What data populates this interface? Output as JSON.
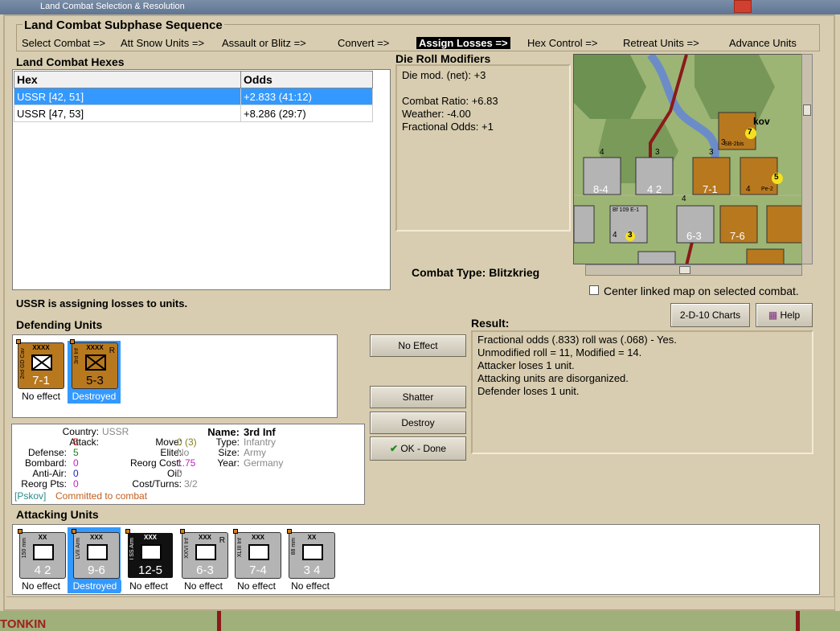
{
  "window": {
    "title": "Land Combat Selection & Resolution",
    "close_icon": "close-icon"
  },
  "sequence": {
    "title": "Land Combat Subphase Sequence",
    "steps": [
      "Select Combat =>",
      "Att Snow Units =>",
      "Assault or Blitz =>",
      "Convert =>",
      "Assign Losses =>",
      "Hex Control =>",
      "Retreat Units =>",
      "Advance Units"
    ],
    "active": "Assign Losses =>"
  },
  "hexes": {
    "title": "Land Combat Hexes",
    "columns": [
      "Hex",
      "Odds"
    ],
    "rows": [
      {
        "hex": "USSR [42, 51]",
        "odds": "+2.833 (41:12)"
      },
      {
        "hex": "USSR [47, 53]",
        "odds": "+8.286 (29:7)"
      }
    ]
  },
  "modifiers": {
    "title": "Die Roll Modifiers",
    "net": "Die mod. (net): +3",
    "combat_ratio": "Combat Ratio: +6.83",
    "weather": "Weather: -4.00",
    "fractional": "Fractional Odds: +1"
  },
  "combat_type": {
    "label": "Combat Type:",
    "value": "Blitzkrieg"
  },
  "center_map": {
    "label": "Center linked map on selected combat.",
    "checked": false
  },
  "assigning": "USSR is assigning losses to units.",
  "buttons": {
    "charts": "2-D-10 Charts",
    "help": "Help",
    "no_effect": "No Effect",
    "shatter": "Shatter",
    "destroy": "Destroy",
    "ok": "OK - Done"
  },
  "defending": {
    "title": "Defending Units",
    "units": [
      {
        "side": "2nd GD Cav",
        "size": "XXXX",
        "strength": "7-1",
        "status": "No effect",
        "flag": ""
      },
      {
        "side": "3rd Inf",
        "size": "XXXX",
        "strength": "5-3",
        "status": "Destroyed",
        "flag": "R"
      }
    ]
  },
  "result": {
    "title": "Result:",
    "lines": [
      "Fractional odds (.833) roll was (.068)  - Yes.",
      "Unmodified roll = 11, Modified = 14.",
      "Attacker loses 1 unit.",
      "Attacking units are disorganized.",
      "Defender loses 1 unit."
    ]
  },
  "info": {
    "country": {
      "k": "Country:",
      "v": "USSR"
    },
    "attack": {
      "k": "Attack:",
      "v": "5"
    },
    "defense": {
      "k": "Defense:",
      "v": "5"
    },
    "bombard": {
      "k": "Bombard:",
      "v": "0"
    },
    "antiair": {
      "k": "Anti-Air:",
      "v": "0"
    },
    "reorg_pts": {
      "k": "Reorg Pts:",
      "v": "0"
    },
    "move": {
      "k": "Move:",
      "v": "0 (3)"
    },
    "elite": {
      "k": "Elite:",
      "v": "No"
    },
    "reorg_cost": {
      "k": "Reorg Cost:",
      "v": "1.75"
    },
    "oil": {
      "k": "Oil:",
      "v": "0"
    },
    "cost_turns": {
      "k": "Cost/Turns:",
      "v": "3/2"
    },
    "name": {
      "k": "Name:",
      "v": "3rd Inf"
    },
    "type": {
      "k": "Type:",
      "v": "Infantry"
    },
    "size": {
      "k": "Size:",
      "v": "Army"
    },
    "year": {
      "k": "Year:",
      "v": "Germany"
    },
    "location": "[Pskov]",
    "committed": "Committed to combat"
  },
  "attacking": {
    "title": "Attacking Units",
    "units": [
      {
        "side": "150 mm",
        "size": "XX",
        "strength": "4 2",
        "status": "No effect",
        "color": "gray",
        "flag": ""
      },
      {
        "side": "LVII Arm",
        "size": "XXX",
        "strength": "9-6",
        "status": "Destroyed",
        "color": "gray",
        "flag": ""
      },
      {
        "side": "I SS Arm",
        "size": "XXX",
        "strength": "12-5",
        "status": "No effect",
        "color": "black",
        "flag": ""
      },
      {
        "side": "XXVI Inf",
        "size": "XXX",
        "strength": "6-3",
        "status": "No effect",
        "color": "gray",
        "flag": "R"
      },
      {
        "side": "XLIII Inf",
        "size": "XXX",
        "strength": "7-4",
        "status": "No effect",
        "color": "gray",
        "flag": ""
      },
      {
        "side": "88 mm",
        "size": "XX",
        "strength": "3 4",
        "status": "No effect",
        "color": "gray",
        "flag": ""
      }
    ]
  },
  "map": {
    "label_city": "kov",
    "label_bottom": "TONKIN",
    "units": [
      {
        "label": "SB-2bis",
        "value": "7",
        "extra": "3"
      },
      {
        "label": "Pe-2",
        "value": "5",
        "extra": "4"
      },
      {
        "label": "Bf 109 E-1",
        "value": "3",
        "extra": "4"
      },
      {
        "label": "8-4",
        "value": "",
        "extra": "4"
      },
      {
        "label": "4 2",
        "value": "",
        "extra": "3"
      },
      {
        "label": "7-1",
        "value": "",
        "extra": "3"
      },
      {
        "label": "6-3",
        "value": "",
        "extra": "4"
      },
      {
        "label": "7-6",
        "value": "",
        "extra": ""
      }
    ]
  }
}
